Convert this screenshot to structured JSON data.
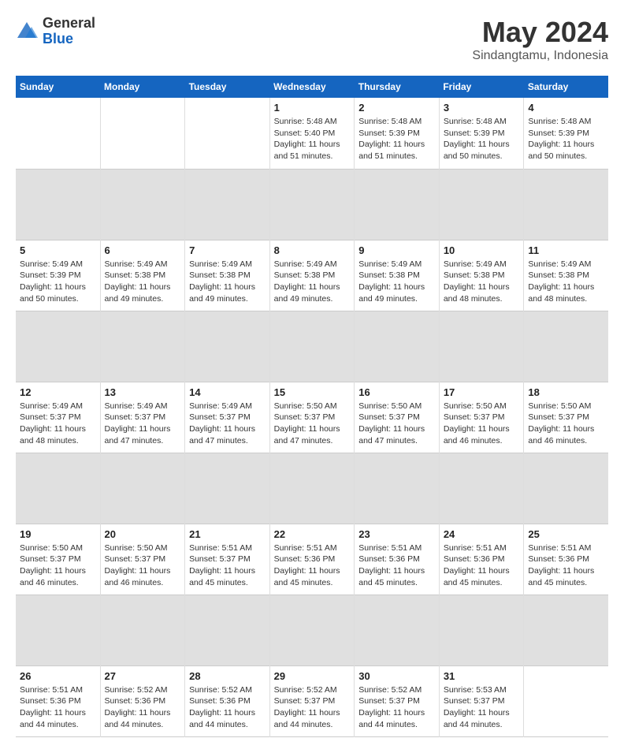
{
  "logo": {
    "general": "General",
    "blue": "Blue"
  },
  "title": "May 2024",
  "subtitle": "Sindangtamu, Indonesia",
  "days_header": [
    "Sunday",
    "Monday",
    "Tuesday",
    "Wednesday",
    "Thursday",
    "Friday",
    "Saturday"
  ],
  "weeks": [
    {
      "cells": [
        {
          "day": "",
          "info": ""
        },
        {
          "day": "",
          "info": ""
        },
        {
          "day": "",
          "info": ""
        },
        {
          "day": "1",
          "info": "Sunrise: 5:48 AM\nSunset: 5:40 PM\nDaylight: 11 hours\nand 51 minutes."
        },
        {
          "day": "2",
          "info": "Sunrise: 5:48 AM\nSunset: 5:39 PM\nDaylight: 11 hours\nand 51 minutes."
        },
        {
          "day": "3",
          "info": "Sunrise: 5:48 AM\nSunset: 5:39 PM\nDaylight: 11 hours\nand 50 minutes."
        },
        {
          "day": "4",
          "info": "Sunrise: 5:48 AM\nSunset: 5:39 PM\nDaylight: 11 hours\nand 50 minutes."
        }
      ]
    },
    {
      "cells": [
        {
          "day": "5",
          "info": "Sunrise: 5:49 AM\nSunset: 5:39 PM\nDaylight: 11 hours\nand 50 minutes."
        },
        {
          "day": "6",
          "info": "Sunrise: 5:49 AM\nSunset: 5:38 PM\nDaylight: 11 hours\nand 49 minutes."
        },
        {
          "day": "7",
          "info": "Sunrise: 5:49 AM\nSunset: 5:38 PM\nDaylight: 11 hours\nand 49 minutes."
        },
        {
          "day": "8",
          "info": "Sunrise: 5:49 AM\nSunset: 5:38 PM\nDaylight: 11 hours\nand 49 minutes."
        },
        {
          "day": "9",
          "info": "Sunrise: 5:49 AM\nSunset: 5:38 PM\nDaylight: 11 hours\nand 49 minutes."
        },
        {
          "day": "10",
          "info": "Sunrise: 5:49 AM\nSunset: 5:38 PM\nDaylight: 11 hours\nand 48 minutes."
        },
        {
          "day": "11",
          "info": "Sunrise: 5:49 AM\nSunset: 5:38 PM\nDaylight: 11 hours\nand 48 minutes."
        }
      ]
    },
    {
      "cells": [
        {
          "day": "12",
          "info": "Sunrise: 5:49 AM\nSunset: 5:37 PM\nDaylight: 11 hours\nand 48 minutes."
        },
        {
          "day": "13",
          "info": "Sunrise: 5:49 AM\nSunset: 5:37 PM\nDaylight: 11 hours\nand 47 minutes."
        },
        {
          "day": "14",
          "info": "Sunrise: 5:49 AM\nSunset: 5:37 PM\nDaylight: 11 hours\nand 47 minutes."
        },
        {
          "day": "15",
          "info": "Sunrise: 5:50 AM\nSunset: 5:37 PM\nDaylight: 11 hours\nand 47 minutes."
        },
        {
          "day": "16",
          "info": "Sunrise: 5:50 AM\nSunset: 5:37 PM\nDaylight: 11 hours\nand 47 minutes."
        },
        {
          "day": "17",
          "info": "Sunrise: 5:50 AM\nSunset: 5:37 PM\nDaylight: 11 hours\nand 46 minutes."
        },
        {
          "day": "18",
          "info": "Sunrise: 5:50 AM\nSunset: 5:37 PM\nDaylight: 11 hours\nand 46 minutes."
        }
      ]
    },
    {
      "cells": [
        {
          "day": "19",
          "info": "Sunrise: 5:50 AM\nSunset: 5:37 PM\nDaylight: 11 hours\nand 46 minutes."
        },
        {
          "day": "20",
          "info": "Sunrise: 5:50 AM\nSunset: 5:37 PM\nDaylight: 11 hours\nand 46 minutes."
        },
        {
          "day": "21",
          "info": "Sunrise: 5:51 AM\nSunset: 5:37 PM\nDaylight: 11 hours\nand 45 minutes."
        },
        {
          "day": "22",
          "info": "Sunrise: 5:51 AM\nSunset: 5:36 PM\nDaylight: 11 hours\nand 45 minutes."
        },
        {
          "day": "23",
          "info": "Sunrise: 5:51 AM\nSunset: 5:36 PM\nDaylight: 11 hours\nand 45 minutes."
        },
        {
          "day": "24",
          "info": "Sunrise: 5:51 AM\nSunset: 5:36 PM\nDaylight: 11 hours\nand 45 minutes."
        },
        {
          "day": "25",
          "info": "Sunrise: 5:51 AM\nSunset: 5:36 PM\nDaylight: 11 hours\nand 45 minutes."
        }
      ]
    },
    {
      "cells": [
        {
          "day": "26",
          "info": "Sunrise: 5:51 AM\nSunset: 5:36 PM\nDaylight: 11 hours\nand 44 minutes."
        },
        {
          "day": "27",
          "info": "Sunrise: 5:52 AM\nSunset: 5:36 PM\nDaylight: 11 hours\nand 44 minutes."
        },
        {
          "day": "28",
          "info": "Sunrise: 5:52 AM\nSunset: 5:36 PM\nDaylight: 11 hours\nand 44 minutes."
        },
        {
          "day": "29",
          "info": "Sunrise: 5:52 AM\nSunset: 5:37 PM\nDaylight: 11 hours\nand 44 minutes."
        },
        {
          "day": "30",
          "info": "Sunrise: 5:52 AM\nSunset: 5:37 PM\nDaylight: 11 hours\nand 44 minutes."
        },
        {
          "day": "31",
          "info": "Sunrise: 5:53 AM\nSunset: 5:37 PM\nDaylight: 11 hours\nand 44 minutes."
        },
        {
          "day": "",
          "info": ""
        }
      ]
    }
  ]
}
